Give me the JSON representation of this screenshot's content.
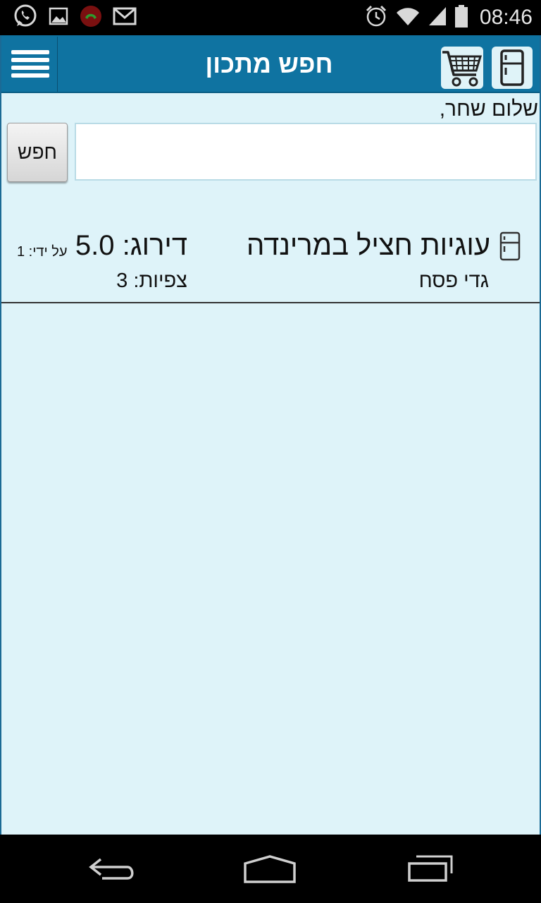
{
  "status_bar": {
    "time": "08:46",
    "left_icons": [
      "whatsapp-icon",
      "gallery-icon",
      "missed-call-icon",
      "gmail-icon"
    ],
    "right_icons": [
      "alarm-icon",
      "wifi-icon",
      "signal-icon",
      "battery-icon"
    ]
  },
  "action_bar": {
    "title": "חפש מתכון",
    "background_color": "#0f73a1"
  },
  "greeting": "שלום שחר,",
  "search": {
    "input_value": "",
    "placeholder": "",
    "button_label": "חפש"
  },
  "results": [
    {
      "name": "עוגיות חציל במרינדה",
      "author": "גדי פסח",
      "rating": "דירוג: 5.0",
      "views": "צפיות: 3",
      "by": "על ידי: 1"
    }
  ],
  "colors": {
    "app_background": "#def3f9",
    "accent": "#0f73a1"
  }
}
